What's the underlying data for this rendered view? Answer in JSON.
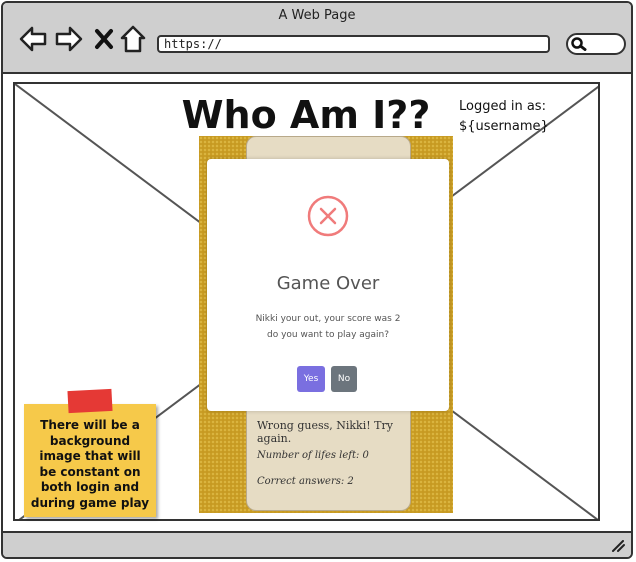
{
  "window": {
    "title": "A Web Page"
  },
  "browser": {
    "url": "https://"
  },
  "page": {
    "title": "Who Am I??",
    "logged_in_label": "Logged in as:",
    "username": "${username}"
  },
  "game_card": {
    "message": "Wrong guess, Nikki! Try again.",
    "lifes_left": "Number of lifes left: 0",
    "correct_answers": "Correct answers: 2"
  },
  "modal": {
    "icon": "error-x-icon",
    "title": "Game Over",
    "line1": "Nikki your out, your score was 2",
    "line2": "do you want to play again?",
    "yes_label": "Yes",
    "no_label": "No",
    "colors": {
      "yes": "#7a6fe0",
      "no": "#6c757d",
      "error": "#f07b7b"
    }
  },
  "note": {
    "text": "There will be a background image that will be constant on both login and during game play",
    "color": "#f6c94a"
  }
}
